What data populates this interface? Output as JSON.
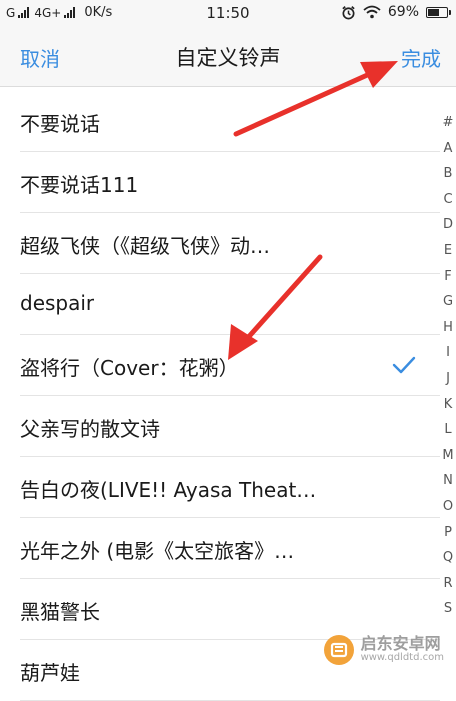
{
  "status_bar": {
    "carrier_1": "G",
    "carrier_2": "4G+",
    "network_speed": "0K/s",
    "time": "11:50",
    "battery_percent": "69%",
    "battery_level": 0.69
  },
  "nav": {
    "cancel_label": "取消",
    "title": "自定义铃声",
    "done_label": "完成"
  },
  "colors": {
    "accent": "#3a8de0",
    "arrow": "#e8312b"
  },
  "ringtones": [
    {
      "label": "不要说话",
      "selected": false
    },
    {
      "label": "不要说话111",
      "selected": false
    },
    {
      "label": "超级飞侠（《超级飞侠》动…",
      "selected": false
    },
    {
      "label": "despair",
      "selected": false
    },
    {
      "label": "盗将行（Cover：花粥）",
      "selected": true
    },
    {
      "label": "父亲写的散文诗",
      "selected": false
    },
    {
      "label": "告白の夜(LIVE!! Ayasa Theat…",
      "selected": false
    },
    {
      "label": "光年之外 (电影《太空旅客》…",
      "selected": false
    },
    {
      "label": "黑猫警长",
      "selected": false
    },
    {
      "label": "葫芦娃",
      "selected": false
    }
  ],
  "index_letters": [
    "#",
    "A",
    "B",
    "C",
    "D",
    "E",
    "F",
    "G",
    "H",
    "I",
    "J",
    "K",
    "L",
    "M",
    "N",
    "O",
    "P",
    "Q",
    "R",
    "S"
  ],
  "watermark": {
    "title": "启东安卓网",
    "url": "www.qdldtd.com"
  }
}
